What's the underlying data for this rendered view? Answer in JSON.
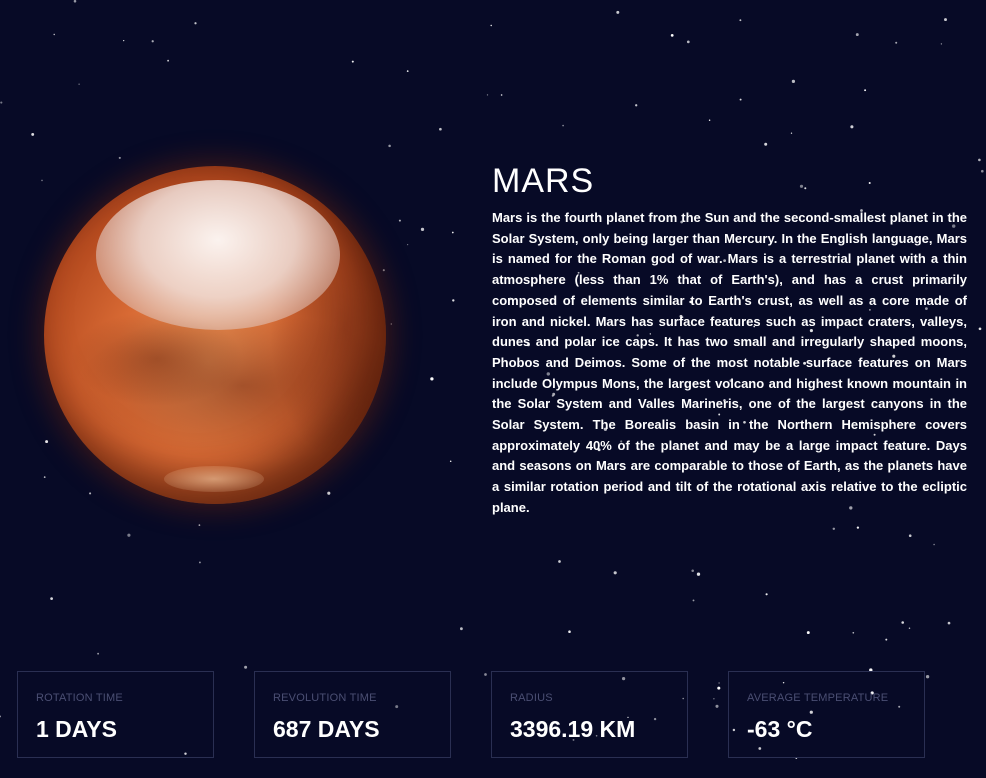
{
  "planet": {
    "name": "MARS",
    "description": "Mars is the fourth planet from the Sun and the second-smallest planet in the Solar System, only being larger than Mercury. In the English language, Mars is named for the Roman god of war. Mars is a terrestrial planet with a thin atmosphere (less than 1% that of Earth's), and has a crust primarily composed of elements similar to Earth's crust, as well as a core made of iron and nickel. Mars has surface features such as impact craters, valleys, dunes and polar ice caps. It has two small and irregularly shaped moons, Phobos and Deimos. Some of the most notable surface features on Mars include Olympus Mons, the largest volcano and highest known mountain in the Solar System and Valles Marineris, one of the largest canyons in the Solar System. The Borealis basin in the Northern Hemisphere covers approximately 40% of the planet and may be a large impact feature. Days and seasons on Mars are comparable to those of Earth, as the planets have a similar rotation period and tilt of the rotational axis relative to the ecliptic plane."
  },
  "stats": [
    {
      "label": "ROTATION TIME",
      "value": "1 DAYS"
    },
    {
      "label": "REVOLUTION TIME",
      "value": "687 DAYS"
    },
    {
      "label": "RADIUS",
      "value": "3396.19 KM"
    },
    {
      "label": "AVERAGE TEMPERATURE",
      "value": "-63 °C"
    }
  ],
  "colors": {
    "background": "#070a26",
    "card_border": "#2a2f52",
    "card_label": "#4b4f73",
    "text": "#ffffff"
  }
}
